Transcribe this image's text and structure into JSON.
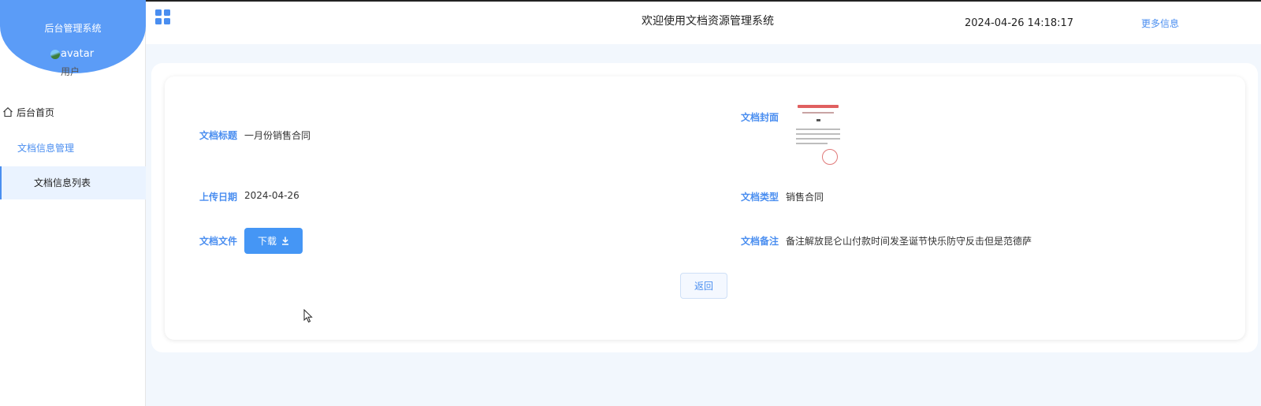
{
  "sidebar": {
    "brand_title": "后台管理系统",
    "avatar_alt": "avatar",
    "user_name": "用户",
    "menu_home": "后台首页",
    "menu_group": "文档信息管理",
    "menu_sub": "文档信息列表"
  },
  "header": {
    "title": "欢迎使用文档资源管理系统",
    "datetime": "2024-04-26 14:18:17",
    "more": "更多信息"
  },
  "detail": {
    "title_label": "文档标题",
    "title_value": "一月份销售合同",
    "cover_label": "文档封面",
    "date_label": "上传日期",
    "date_value": "2024-04-26",
    "type_label": "文档类型",
    "type_value": "销售合同",
    "file_label": "文档文件",
    "download_label": "下载",
    "note_label": "文档备注",
    "note_value": "备注解放昆仑山付款时间发圣诞节快乐防守反击但是范德萨",
    "back_label": "返回"
  },
  "colors": {
    "accent": "#4a8ef0",
    "brand": "#5b9cf7",
    "content_bg": "#f2f7fd"
  }
}
